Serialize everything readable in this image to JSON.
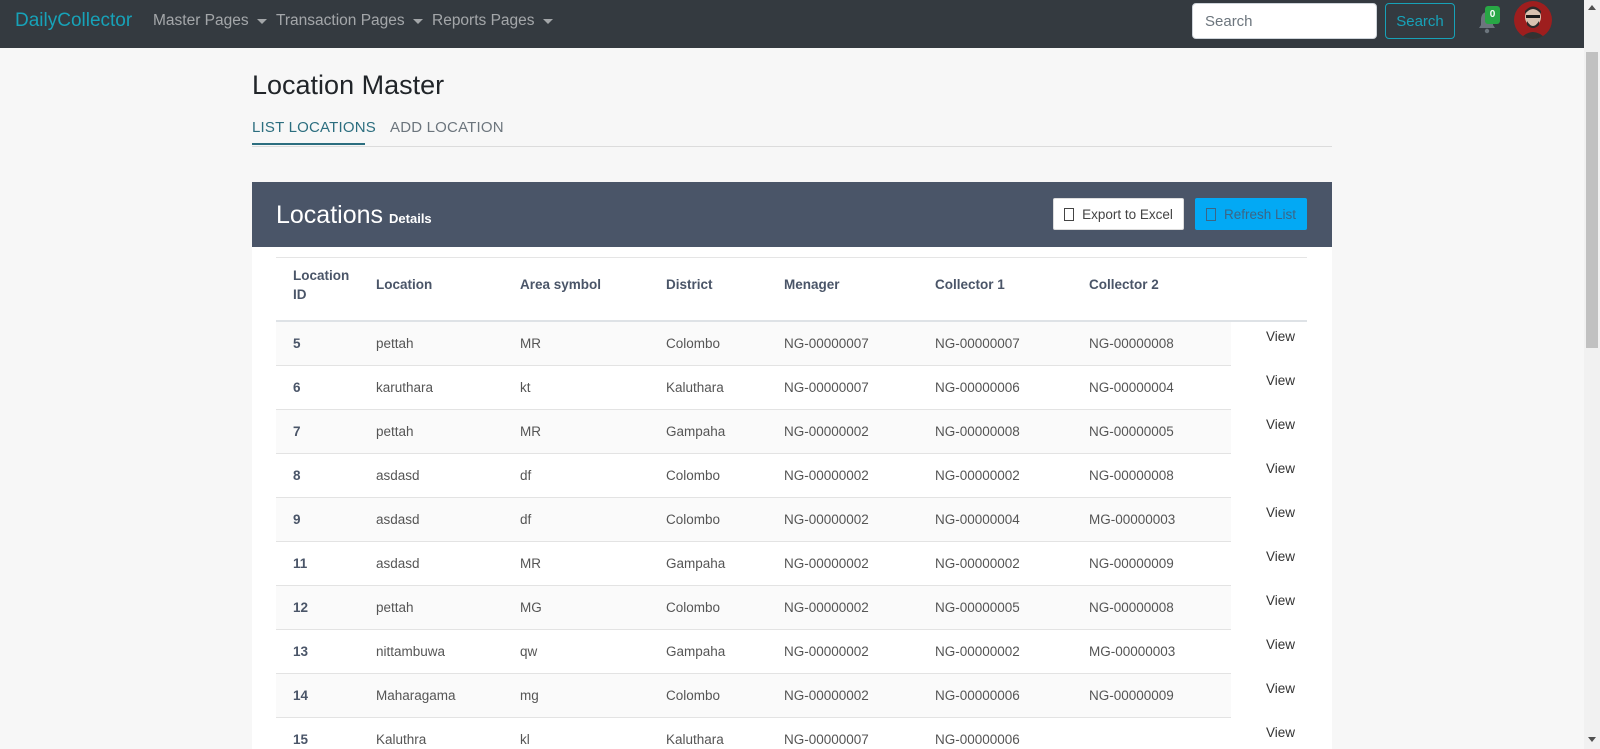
{
  "navbar": {
    "brand": "DailyCollector",
    "menus": [
      {
        "label": "Master Pages"
      },
      {
        "label": "Transaction Pages"
      },
      {
        "label": "Reports Pages"
      }
    ],
    "search_placeholder": "Search",
    "search_button": "Search",
    "notification_count": "0",
    "accent_color": "#17a2b8"
  },
  "page": {
    "title": "Location Master",
    "tabs": [
      {
        "label": "LIST LOCATIONS",
        "active": true
      },
      {
        "label": "ADD LOCATION",
        "active": false
      }
    ]
  },
  "card": {
    "title": "Locations",
    "subtitle": "Details",
    "export_button": "Export to Excel",
    "refresh_button": "Refresh List",
    "header_color": "#4a5568"
  },
  "table": {
    "columns": [
      "Location ID",
      "Location",
      "Area symbol",
      "District",
      "Menager",
      "Collector 1",
      "Collector 2"
    ],
    "view_label": "View",
    "rows": [
      {
        "id": "5",
        "location": "pettah",
        "area": "MR",
        "district": "Colombo",
        "manager": "NG-00000007",
        "collector1": "NG-00000007",
        "collector2": "NG-00000008"
      },
      {
        "id": "6",
        "location": "karuthara",
        "area": "kt",
        "district": "Kaluthara",
        "manager": "NG-00000007",
        "collector1": "NG-00000006",
        "collector2": "NG-00000004"
      },
      {
        "id": "7",
        "location": "pettah",
        "area": "MR",
        "district": "Gampaha",
        "manager": "NG-00000002",
        "collector1": "NG-00000008",
        "collector2": "NG-00000005"
      },
      {
        "id": "8",
        "location": "asdasd",
        "area": "df",
        "district": "Colombo",
        "manager": "NG-00000002",
        "collector1": "NG-00000002",
        "collector2": "NG-00000008"
      },
      {
        "id": "9",
        "location": "asdasd",
        "area": "df",
        "district": "Colombo",
        "manager": "NG-00000002",
        "collector1": "NG-00000004",
        "collector2": "MG-00000003"
      },
      {
        "id": "11",
        "location": "asdasd",
        "area": "MR",
        "district": "Gampaha",
        "manager": "NG-00000002",
        "collector1": "NG-00000002",
        "collector2": "NG-00000009"
      },
      {
        "id": "12",
        "location": "pettah",
        "area": "MG",
        "district": "Colombo",
        "manager": "NG-00000002",
        "collector1": "NG-00000005",
        "collector2": "NG-00000008"
      },
      {
        "id": "13",
        "location": "nittambuwa",
        "area": "qw",
        "district": "Gampaha",
        "manager": "NG-00000002",
        "collector1": "NG-00000002",
        "collector2": "MG-00000003"
      },
      {
        "id": "14",
        "location": "Maharagama",
        "area": "mg",
        "district": "Colombo",
        "manager": "NG-00000002",
        "collector1": "NG-00000006",
        "collector2": "NG-00000009"
      },
      {
        "id": "15",
        "location": "Kaluthra",
        "area": "kl",
        "district": "Kaluthara",
        "manager": "NG-00000007",
        "collector1": "NG-00000006",
        "collector2": ""
      }
    ]
  }
}
